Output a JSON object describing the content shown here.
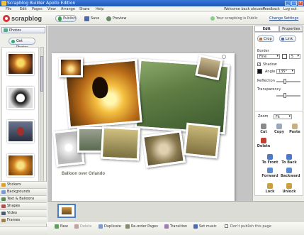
{
  "window": {
    "title": "Scrapblog Builder Apollo Edition"
  },
  "menu": {
    "items": [
      "File",
      "Edit",
      "Pages",
      "View",
      "Arrange",
      "Share",
      "Help"
    ],
    "right": [
      "Welcome back aleuser!",
      "Feedback",
      "Log out"
    ]
  },
  "toolbar": {
    "logo": "scrapblog",
    "publish": "Publish",
    "save": "Save",
    "preview": "Preview",
    "shared_status": "Your scrapblog is Public",
    "change_settings": "Change Settings"
  },
  "left_panel": {
    "photos_tab": "Photos",
    "get_photos": "Get Photos",
    "categories": [
      "Stickers",
      "Backgrounds",
      "Text & Balloons",
      "Shapes",
      "Video",
      "Frames"
    ]
  },
  "canvas": {
    "caption": "Balloon over Orlando"
  },
  "right_panel": {
    "tabs": [
      "Edit",
      "Properties"
    ],
    "crop": "Crop",
    "link": "Link",
    "border_label": "Border",
    "border_style": "Fine",
    "border_size": "5",
    "shadow_label": "Shadow",
    "angle_label": "Angle",
    "angle_value": "135°",
    "reflection_label": "Reflection",
    "transparency_label": "Transparency",
    "zoom_label": "Zoom",
    "zoom_value": "Fit",
    "actions": [
      "Cut",
      "Copy",
      "Paste",
      "Delete",
      "To Front",
      "To Back",
      "Forward",
      "Backward",
      "Lock",
      "Unlock"
    ]
  },
  "bottom_bar": {
    "new": "New",
    "delete": "Delete",
    "duplicate": "Duplicate",
    "reorder": "Re-order Pages",
    "transition": "Transition",
    "set_music": "Set music",
    "dont_publish": "Don't publish this page"
  },
  "colors": {
    "titlebar": "#1d56b8",
    "logo_red": "#d8333a",
    "panel_bg": "#efefea",
    "canvas_bg": "#c4c4c4"
  }
}
